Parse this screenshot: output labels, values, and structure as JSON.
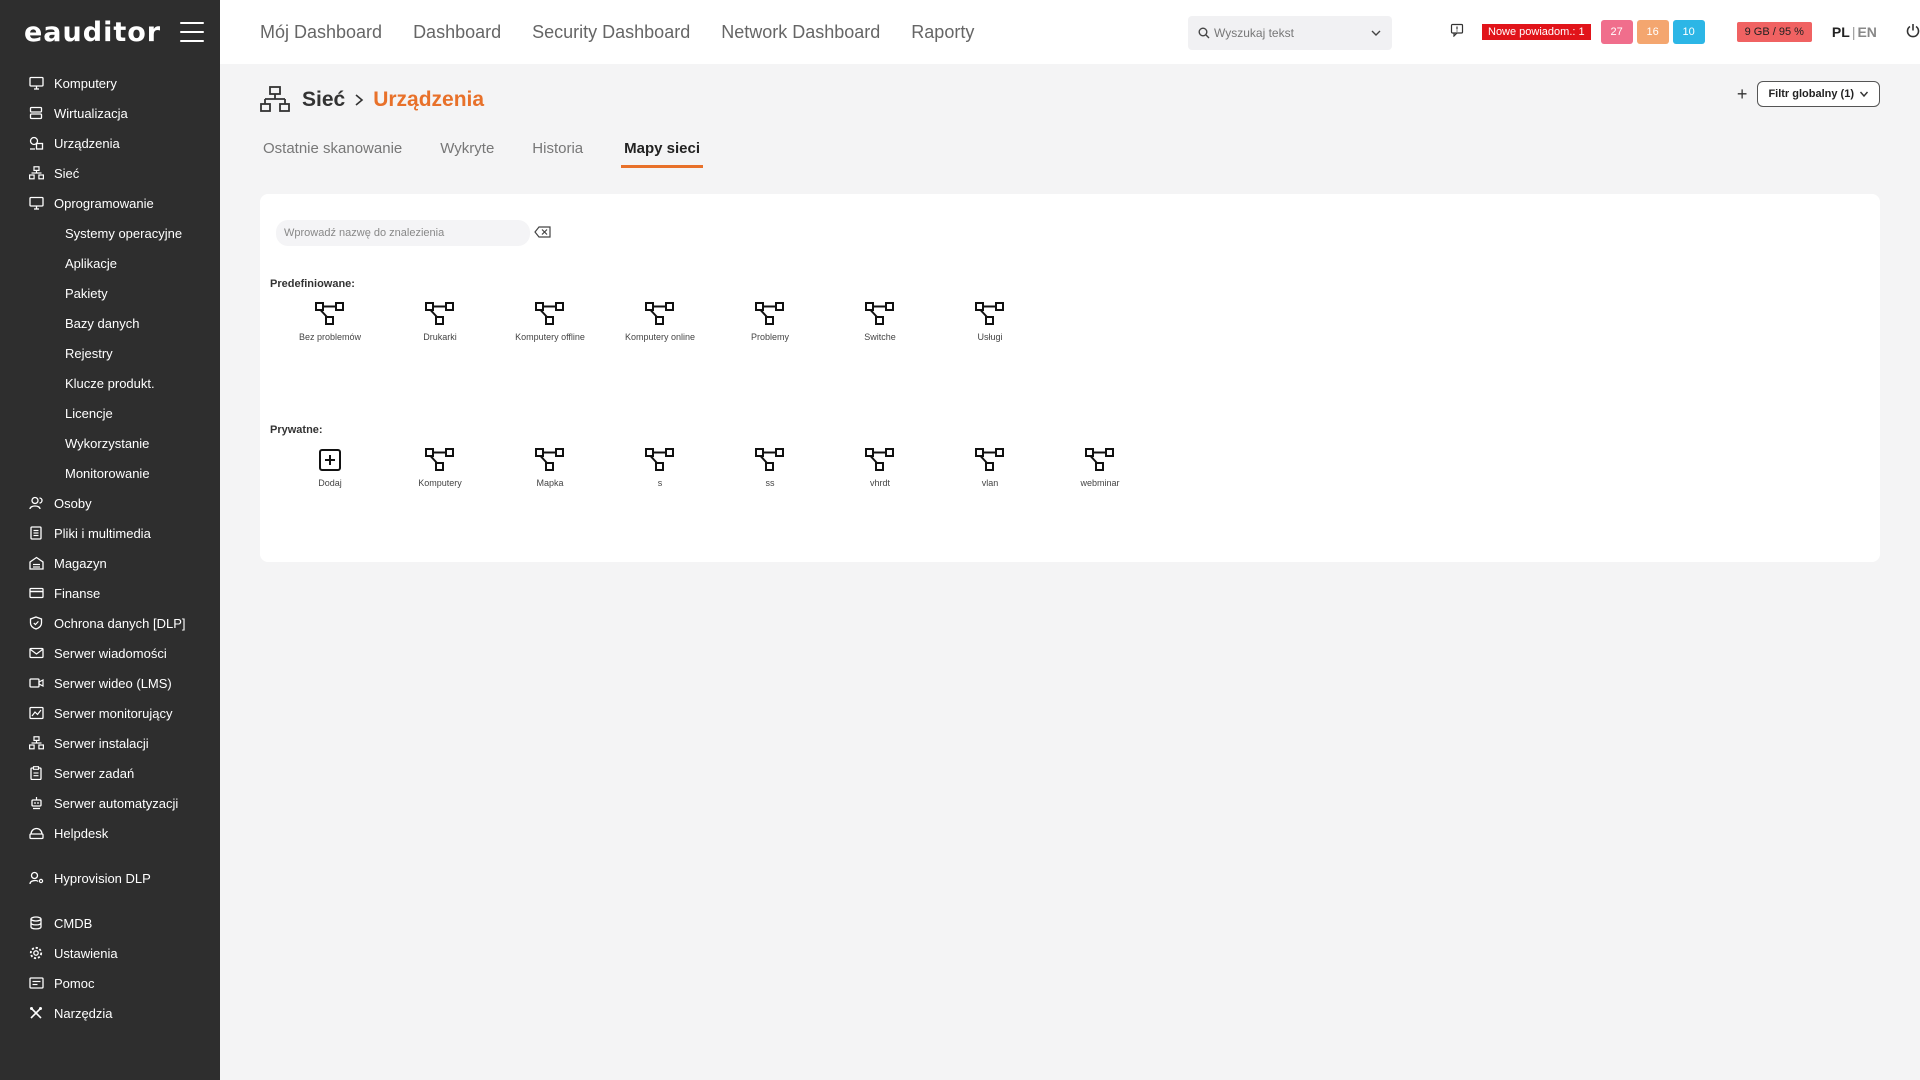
{
  "brand": {
    "logo": "eauditor"
  },
  "sidebar": {
    "items": [
      {
        "label": "Komputery",
        "icon": "monitor-icon"
      },
      {
        "label": "Wirtualizacja",
        "icon": "server-icon"
      },
      {
        "label": "Urządzenia",
        "icon": "devices-icon"
      },
      {
        "label": "Sieć",
        "icon": "network-icon"
      },
      {
        "label": "Oprogramowanie",
        "icon": "monitor-icon"
      },
      {
        "label": "Systemy operacyjne"
      },
      {
        "label": "Aplikacje"
      },
      {
        "label": "Pakiety"
      },
      {
        "label": "Bazy danych"
      },
      {
        "label": "Rejestry"
      },
      {
        "label": "Klucze produkt."
      },
      {
        "label": "Licencje"
      },
      {
        "label": "Wykorzystanie"
      },
      {
        "label": "Monitorowanie"
      },
      {
        "label": "Osoby",
        "icon": "people-icon"
      },
      {
        "label": "Pliki i multimedia",
        "icon": "file-icon"
      },
      {
        "label": "Magazyn",
        "icon": "warehouse-icon"
      },
      {
        "label": "Finanse",
        "icon": "card-icon"
      },
      {
        "label": "Ochrona danych [DLP]",
        "icon": "shield-icon"
      },
      {
        "label": "Serwer wiadomości",
        "icon": "mail-icon"
      },
      {
        "label": "Serwer wideo (LMS)",
        "icon": "video-icon"
      },
      {
        "label": "Serwer monitorujący",
        "icon": "chart-icon"
      },
      {
        "label": "Serwer instalacji",
        "icon": "network-icon"
      },
      {
        "label": "Serwer zadań",
        "icon": "clipboard-icon"
      },
      {
        "label": "Serwer automatyzacji",
        "icon": "robot-icon"
      },
      {
        "label": "Helpdesk",
        "icon": "helpdesk-icon"
      },
      {
        "label": "Hyprovision DLP",
        "icon": "user-key-icon"
      },
      {
        "label": "CMDB",
        "icon": "database-icon"
      },
      {
        "label": "Ustawienia",
        "icon": "gear-icon"
      },
      {
        "label": "Pomoc",
        "icon": "help-icon"
      },
      {
        "label": "Narzędzia",
        "icon": "tools-icon"
      }
    ]
  },
  "topnav": [
    "Mój Dashboard",
    "Dashboard",
    "Security Dashboard",
    "Network Dashboard",
    "Raporty"
  ],
  "search": {
    "placeholder": "Wyszukaj tekst"
  },
  "notifications": {
    "label": "Nowe powiadom.: 1"
  },
  "badges": [
    "27",
    "16",
    "10"
  ],
  "storage": "9 GB / 95 %",
  "lang": {
    "pl": "PL",
    "sep": "|",
    "en": "EN"
  },
  "page": {
    "crumb_parent": "Sieć",
    "crumb_current": "Urządzenia",
    "filter_plus": "+",
    "filter_label": "Filtr globalny (1)"
  },
  "tabs": [
    {
      "label": "Ostatnie skanowanie",
      "active": false
    },
    {
      "label": "Wykryte",
      "active": false
    },
    {
      "label": "Historia",
      "active": false
    },
    {
      "label": "Mapy sieci",
      "active": true
    }
  ],
  "maps": {
    "find_placeholder": "Wprowadź nazwę do znalezienia",
    "predefined_title": "Predefiniowane:",
    "predefined": [
      "Bez problemów",
      "Drukarki",
      "Komputery offline",
      "Komputery online",
      "Problemy",
      "Switche",
      "Usługi"
    ],
    "private_title": "Prywatne:",
    "add_label": "Dodaj",
    "private": [
      "Komputery",
      "Mapka",
      "s",
      "ss",
      "vhrdt",
      "vlan",
      "webminar"
    ]
  },
  "colors": {
    "accent": "#e8712a",
    "sidebar": "#2e2e2e",
    "notif": "#e1141a"
  }
}
